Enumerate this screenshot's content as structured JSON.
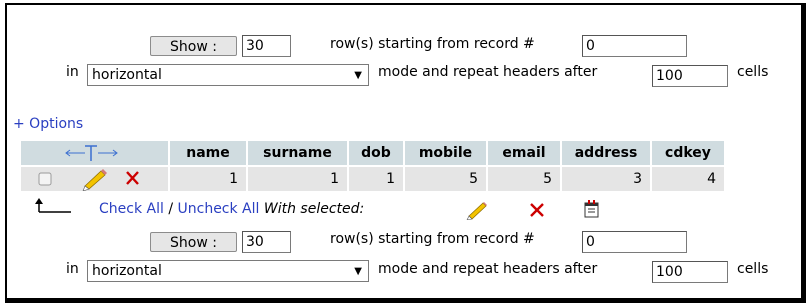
{
  "top_nav": {
    "show_label": "Show :",
    "rows_value": "30",
    "starting_text": "row(s) starting from record #",
    "start_value": "0",
    "in_label": "in",
    "mode_selected": "horizontal",
    "repeat_text": "mode and repeat headers after",
    "repeat_value": "100",
    "cells_label": "cells"
  },
  "options_link": "+ Options",
  "table": {
    "columns": [
      "name",
      "surname",
      "dob",
      "mobile",
      "email",
      "address",
      "cdkey"
    ],
    "rows": [
      {
        "values": [
          "1",
          "1",
          "1",
          "5",
          "5",
          "3",
          "4"
        ]
      }
    ]
  },
  "bulk": {
    "check_all": "Check All",
    "separator": "/",
    "uncheck_all": "Uncheck All",
    "with_selected": "With selected:"
  },
  "bottom_nav": {
    "show_label": "Show :",
    "rows_value": "30",
    "starting_text": "row(s) starting from record #",
    "start_value": "0",
    "in_label": "in",
    "mode_selected": "horizontal",
    "repeat_text": "mode and repeat headers after",
    "repeat_value": "100",
    "cells_label": "cells"
  },
  "colors": {
    "header_bg": "#d0dce0",
    "row_bg": "#e5e5e5",
    "link": "#2a3fc1",
    "delete": "#cc0000"
  }
}
